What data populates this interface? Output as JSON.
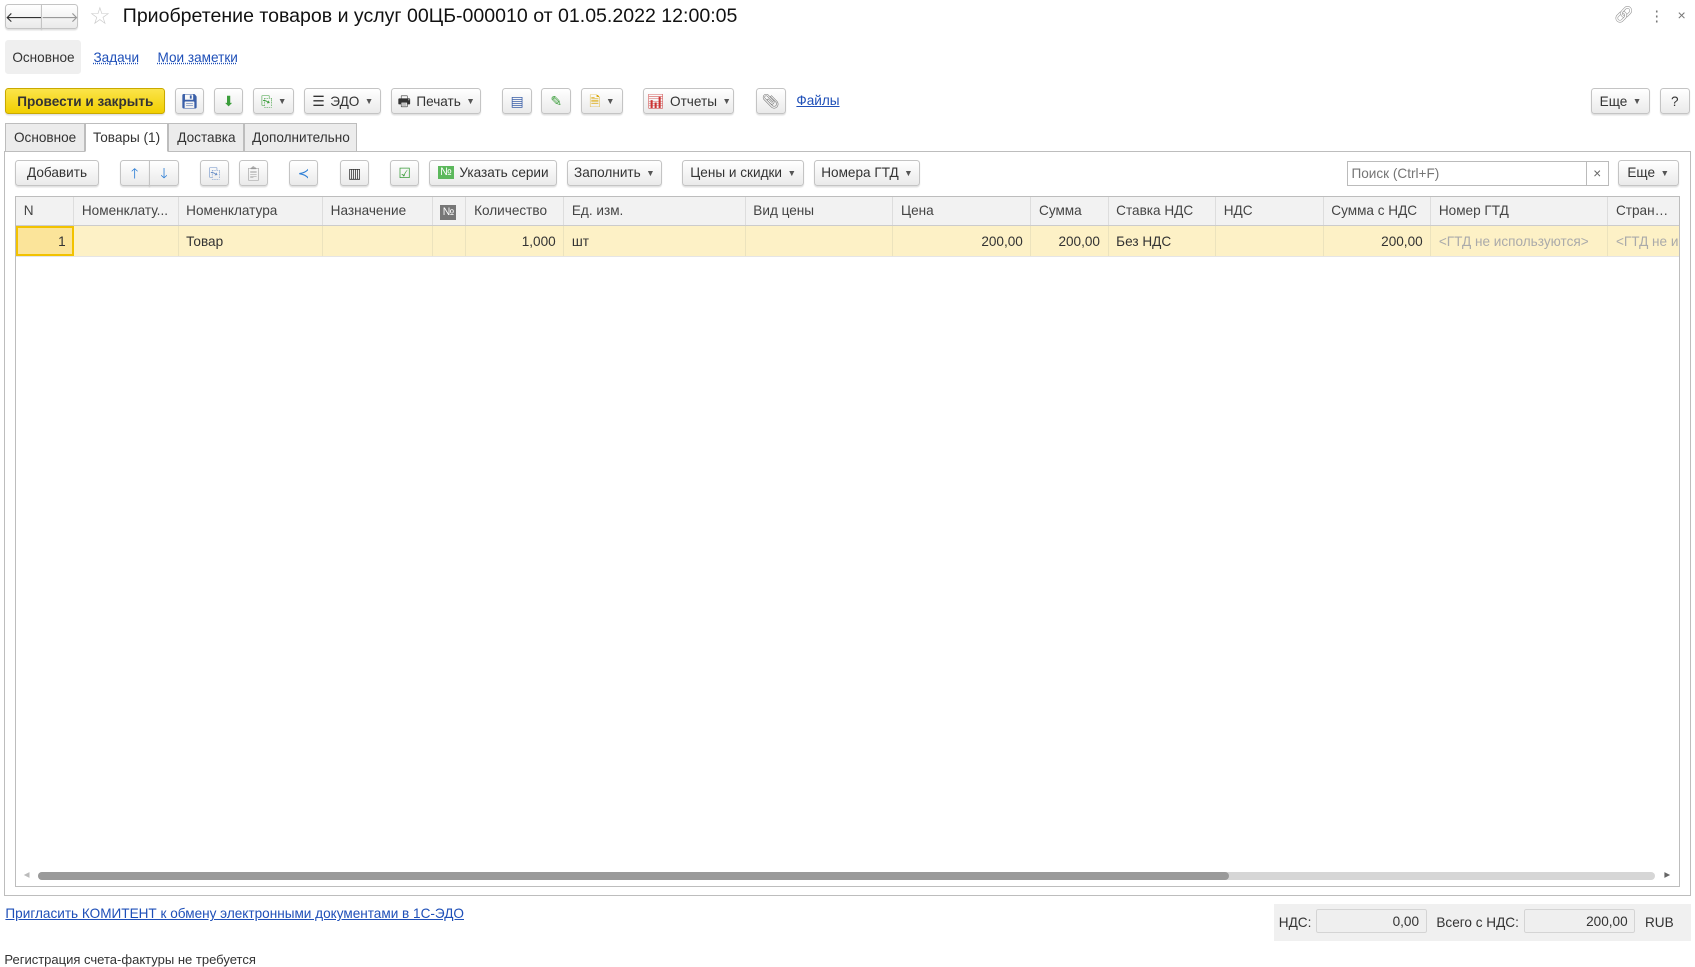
{
  "header": {
    "title": "Приобретение товаров и услуг 00ЦБ-000010 от 01.05.2022 12:00:05"
  },
  "nav_tabs": [
    "Основное",
    "Задачи",
    "Мои заметки"
  ],
  "toolbar": {
    "post_close": "Провести и закрыть",
    "edo": "ЭДО",
    "print": "Печать",
    "reports": "Отчеты",
    "files": "Файлы",
    "more": "Еще",
    "help": "?"
  },
  "page_tabs": [
    "Основное",
    "Товары (1)",
    "Доставка",
    "Дополнительно"
  ],
  "table_toolbar": {
    "add": "Добавить",
    "series": "Указать серии",
    "fill": "Заполнить",
    "prices": "Цены и скидки",
    "gtd": "Номера ГТД",
    "search_placeholder": "Поиск (Ctrl+F)",
    "clear": "×",
    "more": "Еще"
  },
  "table": {
    "columns": [
      "N",
      "Номенклату...",
      "Номенклатура",
      "Назначение",
      "№",
      "Количество",
      "Ед. изм.",
      "Вид цены",
      "Цена",
      "Сумма",
      "Ставка НДС",
      "НДС",
      "Сумма с НДС",
      "Номер ГТД",
      "Страна про"
    ],
    "rows": [
      [
        "1",
        "",
        "Товар",
        "",
        "",
        "1,000",
        "шт",
        "",
        "200,00",
        "200,00",
        "Без НДС",
        "",
        "200,00",
        "<ГТД не используются>",
        "<ГТД не ис"
      ]
    ]
  },
  "footer": {
    "invite_link": "Пригласить КОМИТЕНТ к обмену электронными документами в 1С-ЭДО",
    "vat_label": "НДС:",
    "vat_value": "0,00",
    "total_label": "Всего с НДС:",
    "total_value": "200,00",
    "currency": "RUB",
    "status": "Регистрация счета-фактуры не требуется"
  }
}
